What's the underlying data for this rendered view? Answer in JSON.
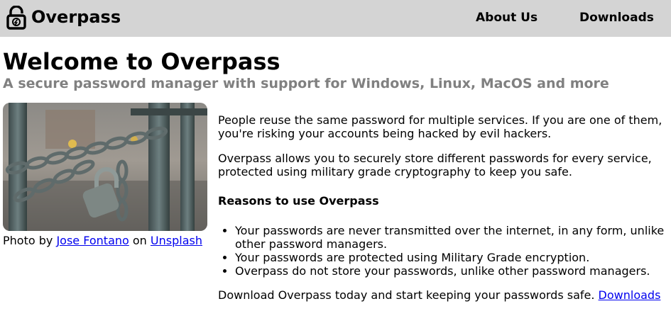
{
  "header": {
    "brand": "Overpass",
    "nav": [
      {
        "label": "About Us"
      },
      {
        "label": "Downloads"
      }
    ]
  },
  "hero": {
    "title": "Welcome to Overpass",
    "subtitle": "A secure password manager with support for Windows, Linux, MacOS and more"
  },
  "photo": {
    "caption_prefix": "Photo by",
    "author": "Jose Fontano",
    "caption_middle": "on",
    "site": "Unsplash"
  },
  "main": {
    "paragraph_1": "People reuse the same password for multiple services. If you are one of them, you're risking your accounts being hacked by evil hackers.",
    "paragraph_2": "Overpass allows you to securely store different passwords for every service, protected using military grade cryptography to keep you safe.",
    "reasons_heading": "Reasons to use Overpass",
    "reasons": [
      "Your passwords are never transmitted over the internet, in any form, unlike other password managers.",
      "Your passwords are protected using Military Grade encryption.",
      "Overpass do not store your passwords, unlike other password managers."
    ],
    "closing_text": "Download Overpass today and start keeping your passwords safe.",
    "closing_link": "Downloads"
  },
  "colors": {
    "header_bg": "#d4d4d4",
    "subtitle": "#808080",
    "link": "#0000ee"
  }
}
